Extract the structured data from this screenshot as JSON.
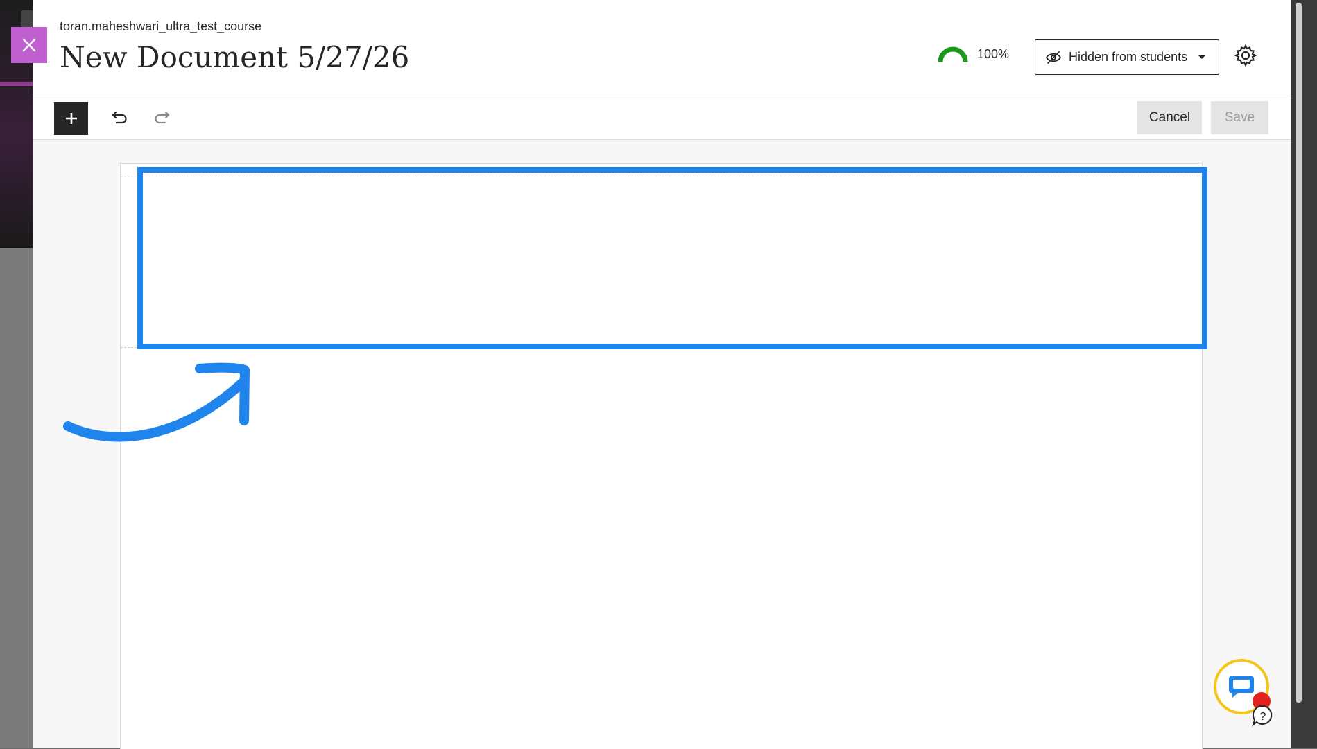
{
  "header": {
    "course_name": "toran.maheshwari_ultra_test_course",
    "title": "New Document 5/27/26",
    "progress_text": "100%",
    "visibility_label": "Hidden from students"
  },
  "toolbar": {
    "cancel_label": "Cancel",
    "save_label": "Save"
  },
  "icons": {
    "close": "close-icon",
    "progress": "progress-arc-icon",
    "visibility": "eye-slash-icon",
    "settings": "gear-icon",
    "add": "plus-icon",
    "undo": "undo-icon",
    "redo": "redo-icon",
    "chat": "chat-icon",
    "help": "help-icon"
  },
  "colors": {
    "close_bg": "#c05fd0",
    "highlight": "#1f84ec",
    "progress": "#1a9a1a",
    "chat_ring": "#f5c518",
    "badge": "#e0231f"
  }
}
